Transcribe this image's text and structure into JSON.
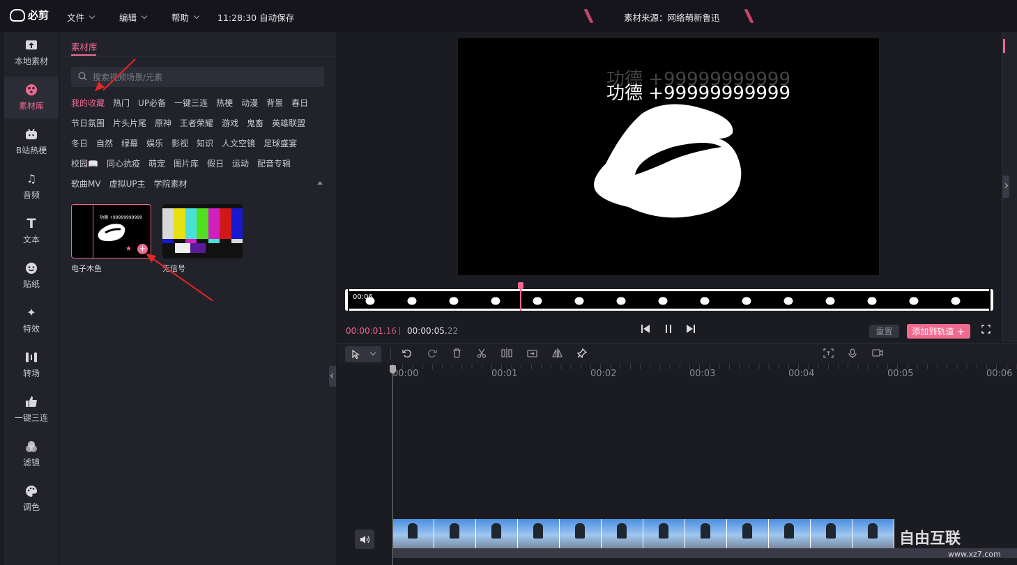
{
  "app": {
    "logo_text": "必剪"
  },
  "menu": {
    "file": "文件",
    "edit": "编辑",
    "help": "帮助"
  },
  "autosave": "11:28:30 自动保存",
  "source": "素材来源：网络萌新鲁迅",
  "sidebar": {
    "items": [
      {
        "label": "本地素材",
        "icon": "upload-icon"
      },
      {
        "label": "素材库",
        "icon": "film-reel-icon",
        "active": true
      },
      {
        "label": "B站热梗",
        "icon": "bilibili-tv-icon"
      },
      {
        "label": "音频",
        "icon": "music-note-icon"
      },
      {
        "label": "文本",
        "icon": "text-t-icon"
      },
      {
        "label": "贴纸",
        "icon": "sticker-icon"
      },
      {
        "label": "特效",
        "icon": "sparkle-icon"
      },
      {
        "label": "转场",
        "icon": "transition-icon"
      },
      {
        "label": "一键三连",
        "icon": "thumbs-up-icon"
      },
      {
        "label": "滤镜",
        "icon": "filter-circles-icon"
      },
      {
        "label": "调色",
        "icon": "palette-icon"
      }
    ]
  },
  "library": {
    "tab": "素材库",
    "search_placeholder": "搜索视频场景/元素",
    "tag_rows": [
      [
        "我的收藏",
        "热门",
        "UP必备",
        "一键三连",
        "热梗",
        "动漫",
        "背景",
        "春日"
      ],
      [
        "节日氛围",
        "片头片尾",
        "原神",
        "王者荣耀",
        "游戏",
        "鬼畜",
        "英雄联盟"
      ],
      [
        "冬日",
        "自然",
        "绿幕",
        "娱乐",
        "影视",
        "知识",
        "人文空镜",
        "足球盛宴"
      ],
      [
        "校园📖",
        "同心抗疫",
        "萌宠",
        "图片库",
        "假日",
        "运动",
        "配音专辑"
      ],
      [
        "歌曲MV",
        "虚拟UP主",
        "学院素材"
      ]
    ],
    "cards": [
      {
        "label": "电子木鱼",
        "thumb_text": "功德 +99999999999"
      },
      {
        "label": "无信号"
      }
    ]
  },
  "preview": {
    "overlay_text": "功德 +99999999999",
    "filmstrip_time": "00:06",
    "current_time_main": "00:00:01.",
    "current_time_frac": "16",
    "total_time_main": "00:00:05.",
    "total_time_frac": "22",
    "reset_label": "重置",
    "add_to_track_label": "添加到轨道"
  },
  "timeline": {
    "ticks": [
      "00:00",
      "00:01",
      "00:02",
      "00:03",
      "00:04",
      "00:05",
      "00:06"
    ]
  },
  "watermark": {
    "text": "自由互联",
    "url": "www.xz7.com"
  },
  "colors": {
    "accent": "#f06a8e",
    "background": "#1b1b22",
    "panel": "#22222b"
  }
}
